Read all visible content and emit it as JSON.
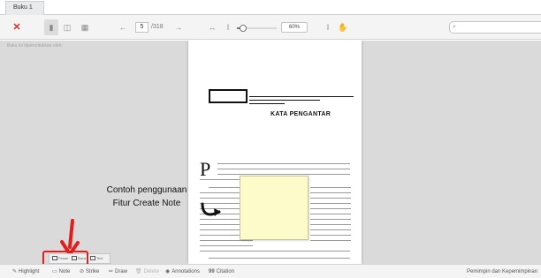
{
  "window": {
    "tab_title": "Buku 1"
  },
  "toolbar": {
    "close_icon": "close-icon",
    "view_icons": [
      "single-page-icon",
      "double-page-icon",
      "grid-view-icon"
    ],
    "prev_icon": "arrow-left-icon",
    "page_number": "5",
    "page_total": "/318",
    "next_icon": "arrow-right-icon",
    "fit_width_icon": "fit-width-icon",
    "text_size_small_icon": "text-cursor-small-icon",
    "zoom_level": "60%",
    "zoom_slider_fraction": 0.15,
    "text_select_icon": "text-cursor-icon",
    "hand_icon": "hand-tool-icon",
    "search_icon": "search-icon",
    "search_placeholder": ""
  },
  "viewer": {
    "watermark": "Buku ini diperuntukkan oleh:",
    "page_heading": "KATA PENGANTAR",
    "dropcap": "P"
  },
  "annotation_popup": {
    "items": [
      "Pesan",
      "Baca",
      "Text"
    ]
  },
  "callout": {
    "line1": "Contoh penggunaan",
    "line2": "Fitur Create Note",
    "color": "#e01e1e"
  },
  "bottombar": {
    "items": [
      {
        "label": "Highlight",
        "icon": "pencil-icon",
        "enabled": true
      },
      {
        "label": "Note",
        "icon": "note-icon",
        "enabled": true
      },
      {
        "label": "Strike",
        "icon": "strike-icon",
        "enabled": true
      },
      {
        "label": "Draw",
        "icon": "draw-icon",
        "enabled": true
      },
      {
        "label": "Delete",
        "icon": "trash-icon",
        "enabled": false
      },
      {
        "label": "Annotations",
        "icon": "eye-icon",
        "enabled": true
      },
      {
        "label": "Citation",
        "icon": "quote-icon",
        "enabled": true
      }
    ],
    "book_title": "Pemimpin dan Kepemimpinan"
  }
}
